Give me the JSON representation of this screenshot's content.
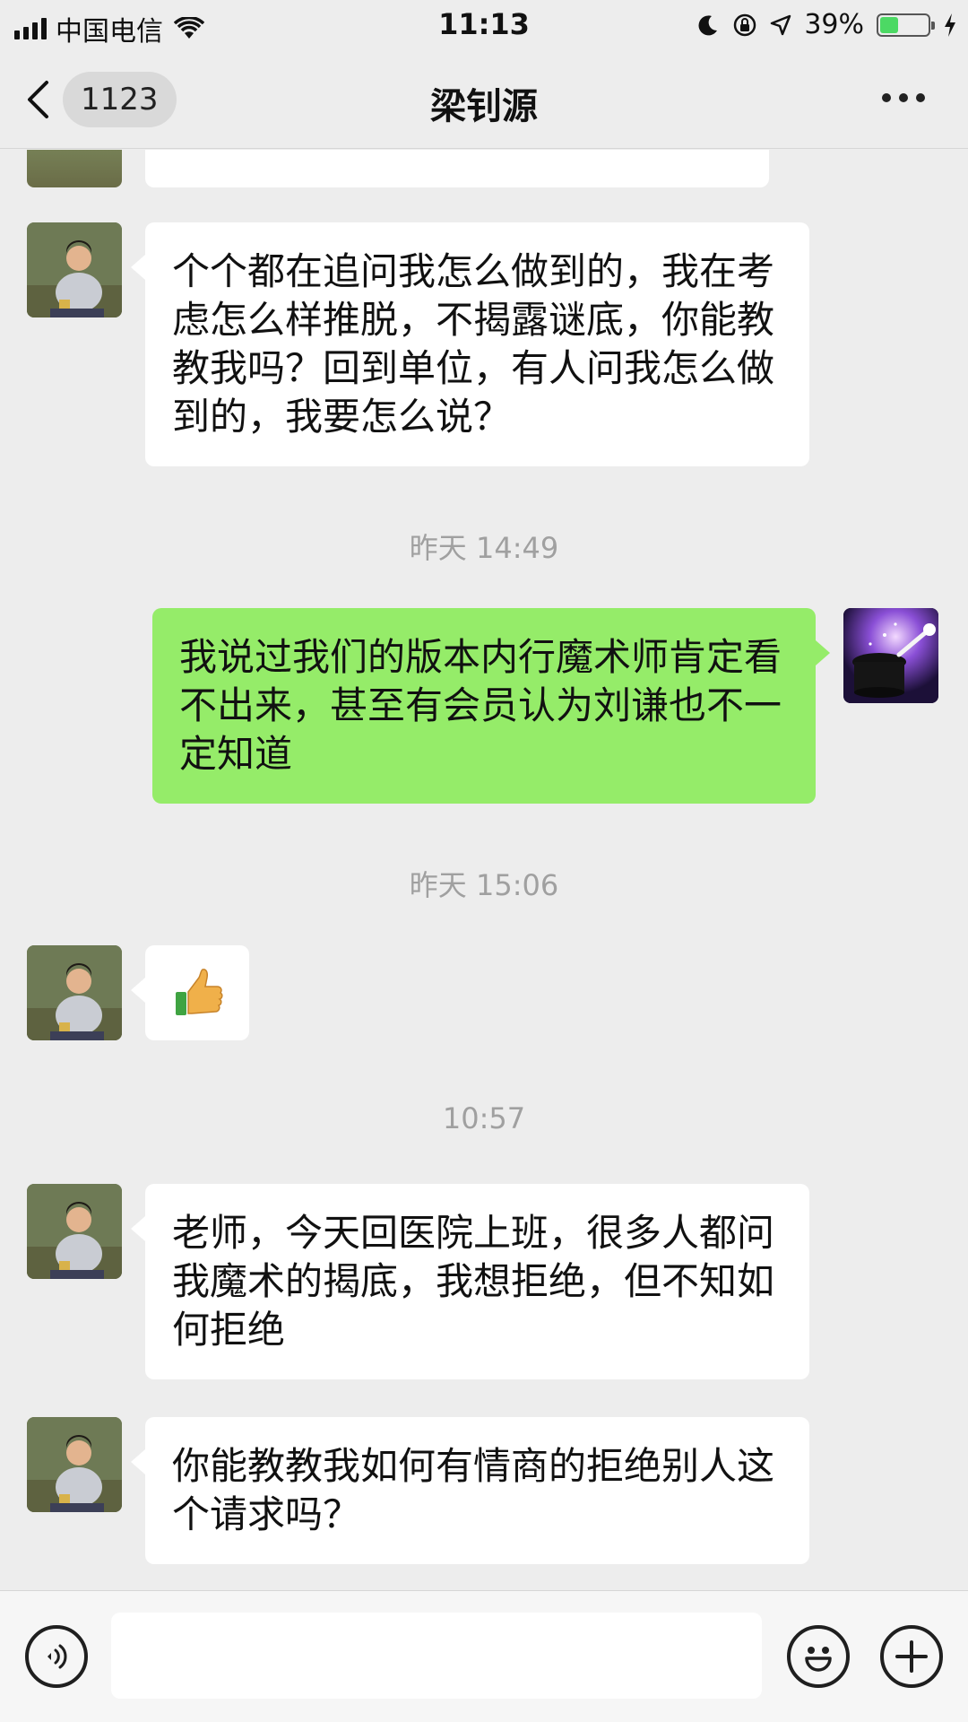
{
  "status_bar": {
    "carrier": "中国电信",
    "time": "11:13",
    "battery_percent": "39%",
    "battery_level": 0.39,
    "icons": [
      "signal-icon",
      "wifi-icon",
      "moon-icon",
      "rotation-lock-icon",
      "location-icon",
      "battery-icon",
      "charging-icon"
    ]
  },
  "nav": {
    "unread_count": "1123",
    "title": "梁钊源",
    "icons": [
      "back-chevron-icon",
      "more-icon"
    ]
  },
  "messages": [
    {
      "side": "in",
      "text": "个个都在追问我怎么做到的，我在考虑怎么样推脱，不揭露谜底，你能教教我吗？回到单位，有人问我怎么做到的，我要怎么说？"
    },
    {
      "type": "time",
      "text": "昨天 14:49"
    },
    {
      "side": "out",
      "text": "我说过我们的版本内行魔术师肯定看不出来，甚至有会员认为刘谦也不一定知道"
    },
    {
      "type": "time",
      "text": "昨天 15:06"
    },
    {
      "side": "in",
      "emoji": "thumbs-up-icon"
    },
    {
      "type": "time",
      "text": "10:57"
    },
    {
      "side": "in",
      "text": "老师，今天回医院上班，很多人都问我魔术的揭底，我想拒绝，但不知如何拒绝"
    },
    {
      "side": "in",
      "text": "你能教教我如何有情商的拒绝别人这个请求吗？"
    }
  ],
  "input_bar": {
    "value": "",
    "icons": [
      "voice-icon",
      "emoji-icon",
      "plus-icon"
    ]
  },
  "colors": {
    "background": "#ededed",
    "incoming_bubble": "#ffffff",
    "outgoing_bubble": "#95ec69",
    "timestamp": "#a0a0a0",
    "battery_green": "#4cd964"
  }
}
